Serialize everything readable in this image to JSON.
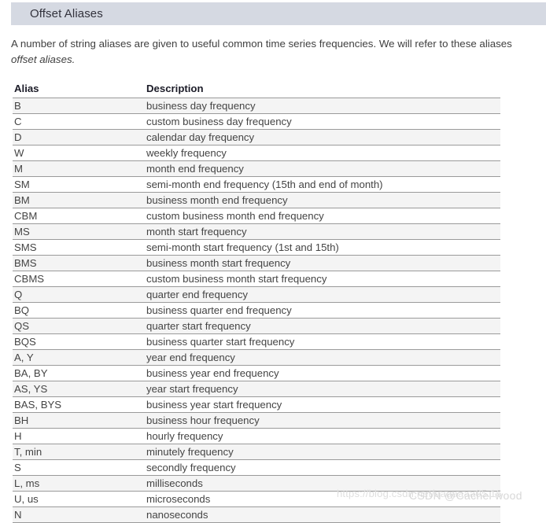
{
  "header": {
    "title": "Offset Aliases"
  },
  "intro": {
    "line1": "A number of string aliases are given to useful common time series frequencies. We will refer to these aliases",
    "line2": "offset aliases."
  },
  "table": {
    "columns": [
      "Alias",
      "Description"
    ],
    "rows": [
      {
        "alias": "B",
        "description": "business day frequency"
      },
      {
        "alias": "C",
        "description": "custom business day frequency"
      },
      {
        "alias": "D",
        "description": "calendar day frequency"
      },
      {
        "alias": "W",
        "description": "weekly frequency"
      },
      {
        "alias": "M",
        "description": "month end frequency"
      },
      {
        "alias": "SM",
        "description": "semi-month end frequency (15th and end of month)"
      },
      {
        "alias": "BM",
        "description": "business month end frequency"
      },
      {
        "alias": "CBM",
        "description": "custom business month end frequency"
      },
      {
        "alias": "MS",
        "description": "month start frequency"
      },
      {
        "alias": "SMS",
        "description": "semi-month start frequency (1st and 15th)"
      },
      {
        "alias": "BMS",
        "description": "business month start frequency"
      },
      {
        "alias": "CBMS",
        "description": "custom business month start frequency"
      },
      {
        "alias": "Q",
        "description": "quarter end frequency"
      },
      {
        "alias": "BQ",
        "description": "business quarter end frequency"
      },
      {
        "alias": "QS",
        "description": "quarter start frequency"
      },
      {
        "alias": "BQS",
        "description": "business quarter start frequency"
      },
      {
        "alias": "A, Y",
        "description": "year end frequency"
      },
      {
        "alias": "BA, BY",
        "description": "business year end frequency"
      },
      {
        "alias": "AS, YS",
        "description": "year start frequency"
      },
      {
        "alias": "BAS, BYS",
        "description": "business year start frequency"
      },
      {
        "alias": "BH",
        "description": "business hour frequency"
      },
      {
        "alias": "H",
        "description": "hourly frequency"
      },
      {
        "alias": "T, min",
        "description": "minutely frequency"
      },
      {
        "alias": "S",
        "description": "secondly frequency"
      },
      {
        "alias": "L, ms",
        "description": "milliseconds"
      },
      {
        "alias": "U, us",
        "description": "microseconds"
      },
      {
        "alias": "N",
        "description": "nanoseconds"
      }
    ]
  },
  "watermark": {
    "url": "https://blog.csdn.net/aaaaaaa05.16",
    "brand": "CSDN @Cachel wood"
  },
  "colors": {
    "header_bar": "#d5d9e2",
    "row_shaded": "#f4f4f4",
    "row_border": "#9a9a9a",
    "text": "#404040",
    "heading_text": "#1c1c28"
  }
}
